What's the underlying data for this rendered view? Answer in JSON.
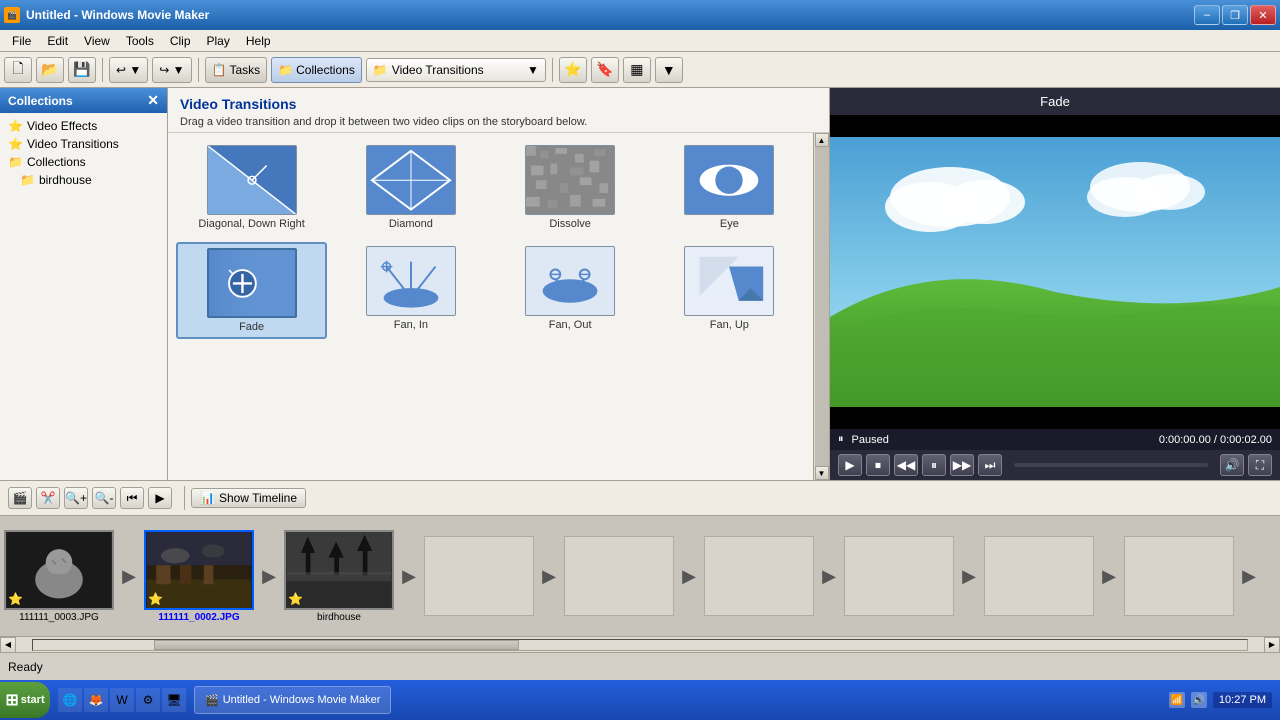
{
  "window": {
    "title": "Untitled - Windows Movie Maker",
    "icon": "🎬"
  },
  "titlebar": {
    "minimize": "–",
    "restore": "❐",
    "close": "✕"
  },
  "menu": {
    "items": [
      "File",
      "Edit",
      "View",
      "Tools",
      "Clip",
      "Play",
      "Help"
    ]
  },
  "toolbar": {
    "new_label": "🗋",
    "open_label": "📂",
    "save_label": "💾",
    "undo_label": "↩",
    "redo_label": "↪",
    "tasks_label": "Tasks",
    "collections_label": "Collections",
    "dropdown_label": "Video Transitions",
    "dropdown_arrow": "▼",
    "icon1": "⭐",
    "icon2": "🔖",
    "icon3": "▦",
    "icon4": "▼"
  },
  "left_panel": {
    "title": "Collections",
    "close": "✕",
    "items": [
      {
        "id": "video-effects",
        "label": "Video Effects",
        "icon": "⭐",
        "indent": 0
      },
      {
        "id": "video-transitions",
        "label": "Video Transitions",
        "icon": "⭐",
        "indent": 0
      },
      {
        "id": "collections",
        "label": "Collections",
        "icon": "📁",
        "indent": 0
      },
      {
        "id": "birdhouse",
        "label": "birdhouse",
        "icon": "📁",
        "indent": 1
      }
    ]
  },
  "transitions": {
    "title": "Video Transitions",
    "description": "Drag a video transition and drop it between two video clips on the storyboard below.",
    "items": [
      {
        "id": "diagonal-down-right",
        "label": "Diagonal, Down Right",
        "type": "diagonal"
      },
      {
        "id": "diamond",
        "label": "Diamond",
        "type": "diamond"
      },
      {
        "id": "dissolve",
        "label": "Dissolve",
        "type": "dissolve"
      },
      {
        "id": "eye",
        "label": "Eye",
        "type": "eye"
      },
      {
        "id": "fade",
        "label": "Fade",
        "type": "fade",
        "selected": true
      },
      {
        "id": "fan-in",
        "label": "Fan, In",
        "type": "fan-in"
      },
      {
        "id": "fan-out",
        "label": "Fan, Out",
        "type": "fan-out"
      },
      {
        "id": "fan-up",
        "label": "Fan, Up",
        "type": "fan-up"
      }
    ]
  },
  "preview": {
    "title": "Fade",
    "status": "Paused",
    "time": "0:00:00.00 / 0:00:02.00",
    "controls": [
      "⏮",
      "⏹",
      "◀◀",
      "⏸",
      "▶▶",
      "⏭"
    ]
  },
  "storyboard": {
    "show_timeline_label": "Show Timeline",
    "clips": [
      {
        "id": "clip1",
        "label": "111111_0003.JPG",
        "selected": false,
        "empty": false
      },
      {
        "id": "clip2",
        "label": "111111_0002.JPG",
        "selected": true,
        "empty": false
      },
      {
        "id": "clip3",
        "label": "birdhouse",
        "selected": false,
        "empty": false
      }
    ]
  },
  "status": {
    "text": "Ready"
  },
  "taskbar": {
    "start_label": "start",
    "time": "10:27 PM",
    "app_label": "Untitled - Windows Movie Maker"
  }
}
